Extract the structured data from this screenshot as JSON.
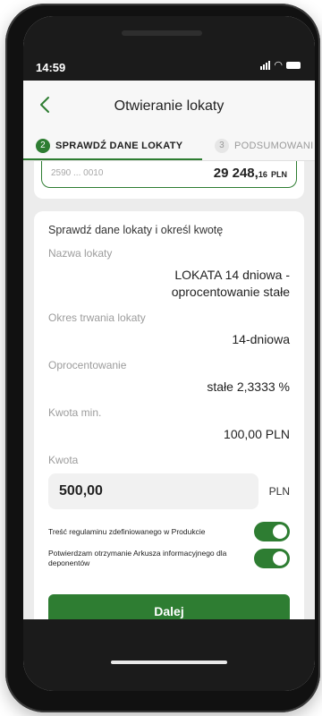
{
  "status_bar": {
    "time": "14:59",
    "icons": [
      "signal-icon",
      "wifi-icon",
      "battery-icon"
    ]
  },
  "header": {
    "title": "Otwieranie lokaty",
    "back_icon": "chevron-left-icon"
  },
  "steps": {
    "active": {
      "number": "2",
      "label": "SPRAWDŹ DANE LOKATY"
    },
    "next": {
      "number": "3",
      "label": "PODSUMOWANI"
    }
  },
  "account": {
    "number": "2590 ... 0010",
    "balance_main": "29 248,",
    "balance_decimals": "16",
    "balance_currency": "PLN"
  },
  "details": {
    "intro": "Sprawdź dane lokaty i określ kwotę",
    "name_label": "Nazwa lokaty",
    "name_line1": "LOKATA 14 dniowa -",
    "name_line2": "oprocentowanie stałe",
    "period_label": "Okres trwania lokaty",
    "period_value": "14-dniowa",
    "rate_label": "Oprocentowanie",
    "rate_value": "stałe 2,3333 %",
    "min_label": "Kwota min.",
    "min_value": "100,00 PLN",
    "amount_label": "Kwota",
    "amount_value": "500,00",
    "amount_currency": "PLN"
  },
  "consents": {
    "terms_text": "Treść regulaminu zdefiniowanego w Produkcie",
    "terms_on": true,
    "info_text": "Potwierdzam otrzymanie Arkusza informacyjnego dla deponentów",
    "info_on": true
  },
  "actions": {
    "next_label": "Dalej"
  },
  "colors": {
    "accent": "#2e7d32",
    "background": "#ececec",
    "card": "#ffffff"
  }
}
